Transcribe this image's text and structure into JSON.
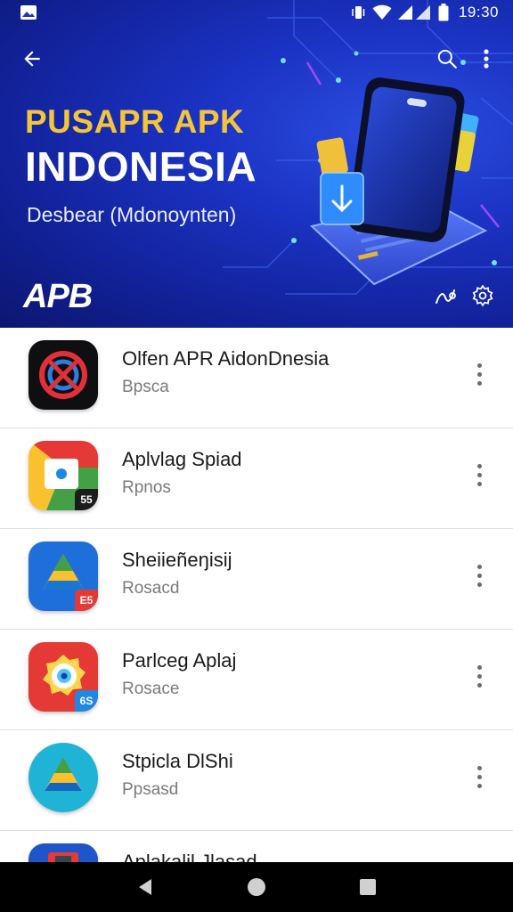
{
  "status_bar": {
    "time": "19:30",
    "icons": [
      "image-icon",
      "vibrate-icon",
      "wifi-icon",
      "signal-icon",
      "battery-icon"
    ]
  },
  "app_bar": {
    "back_icon": "arrow-left-icon",
    "search_icon": "search-icon",
    "more_icon": "more-vert-icon"
  },
  "hero": {
    "title_line1": "PUSAPR APK",
    "title_line2": "INDONESIA",
    "subtitle": "Desbear (Mdonoynten)",
    "logo_text": "APB",
    "colors": {
      "background": "#1b33c4",
      "title_accent": "#f2c53a"
    }
  },
  "apps": [
    {
      "name": "Olfen APR AidonDnesia",
      "subtitle": "Bpsca",
      "icon": "x-circle-app-icon",
      "badge": ""
    },
    {
      "name": "Aplvlag Spiad",
      "subtitle": "Rpnos",
      "icon": "chrome-like-app-icon",
      "badge": "55"
    },
    {
      "name": "Sheiieñeŋisij",
      "subtitle": "Rosacd",
      "icon": "drive-like-app-icon",
      "badge": "E5"
    },
    {
      "name": "Parlceg Aplaj",
      "subtitle": "Rosace",
      "icon": "camera-app-icon",
      "badge": "6S"
    },
    {
      "name": "Stpicla DlShi",
      "subtitle": "Ppsasd",
      "icon": "drive-triangle-app-icon",
      "badge": ""
    },
    {
      "name": "Aplakalil Jlasad",
      "subtitle": "",
      "icon": "partial-app-icon",
      "badge": ""
    }
  ],
  "nav_bar": {
    "back": "nav-back-icon",
    "home": "nav-home-icon",
    "recents": "nav-recents-icon"
  }
}
